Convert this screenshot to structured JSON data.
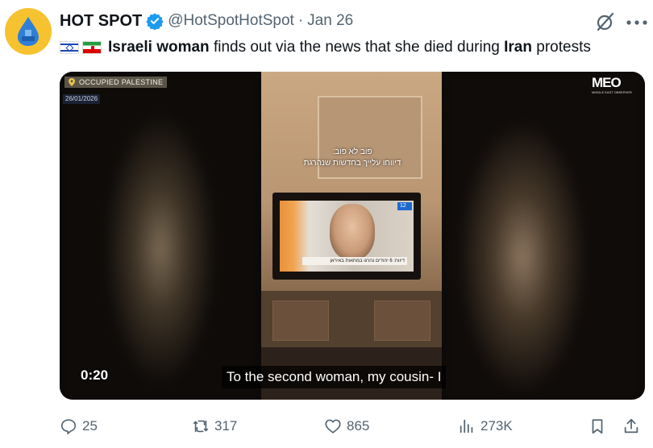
{
  "tweet": {
    "author": {
      "display_name": "HOT SPOT",
      "handle": "@HotSpotHotSpot",
      "separator": "·",
      "date": "Jan 26",
      "verified": true,
      "avatar_icon": "water-drop-icon",
      "avatar_color": "#f6c230"
    },
    "text": {
      "flags": [
        "israel-flag-icon",
        "iran-flag-icon"
      ],
      "bold_1": "Israeli woman",
      "mid": " finds out via the news that she died during ",
      "bold_2": "Iran",
      "end": " protests"
    },
    "media": {
      "location_tag": "OCCUPIED PALESTINE",
      "date_tag": "26/01/2026",
      "logo_text": "MEO",
      "logo_subtext": "MIDDLE EAST OBSERVER",
      "hebrew_caption_line1": "פוב לא פוב:",
      "hebrew_caption_line2": "דיווחו עלייך בחדשות שנהרגת",
      "tv_banner": "דיווח: 6 יהודים נהרגו במחאות באיראן",
      "tv_channel": "12",
      "subtitle": "To the second woman, my cousin- I",
      "timestamp": "0:20"
    },
    "actions": {
      "replies": "25",
      "reposts": "317",
      "likes": "865",
      "views": "273K"
    }
  },
  "colors": {
    "text_primary": "#0f1419",
    "text_secondary": "#536471",
    "verified_blue": "#1d9bf0"
  }
}
